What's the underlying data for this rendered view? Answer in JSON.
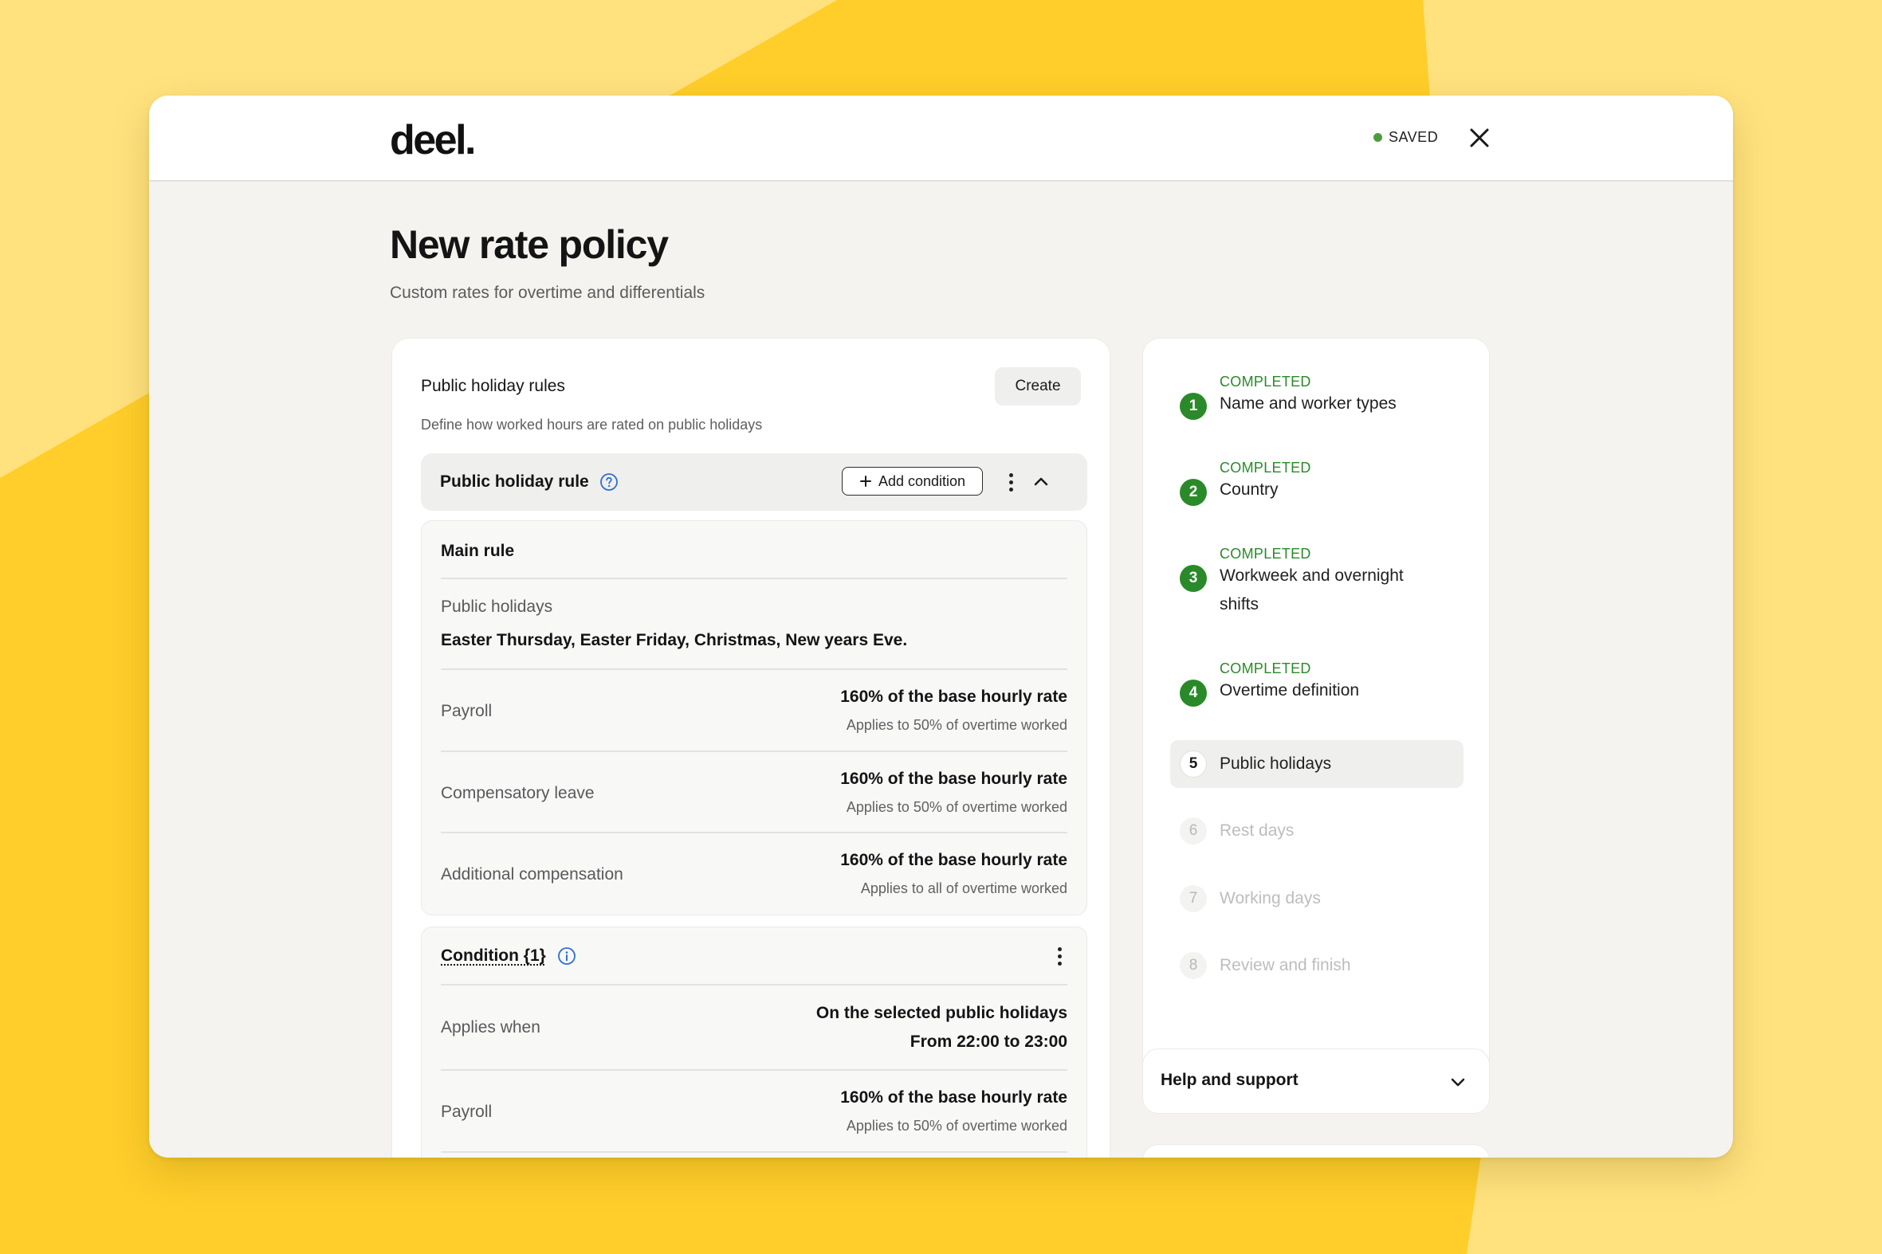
{
  "brand": {
    "logo_text": "deel.",
    "accent": "#ffce2a",
    "accent_light": "#ffe27e",
    "success": "#2a8a2a"
  },
  "header": {
    "saved_label": "SAVED",
    "close_icon": "close-icon"
  },
  "page": {
    "title": "New rate policy",
    "subtitle": "Custom rates for overtime and differentials"
  },
  "section": {
    "title": "Public holiday rules",
    "create_label": "Create",
    "description": "Define how worked hours are rated on public holidays"
  },
  "rule": {
    "title": "Public holiday rule",
    "add_condition_label": "Add condition",
    "main_rule": {
      "title": "Main rule",
      "holidays_label": "Public holidays",
      "holidays_value": "Easter Thursday, Easter Friday, Christmas, New years Eve.",
      "rows": [
        {
          "label": "Payroll",
          "value": "160% of the base hourly rate",
          "note": "Applies to 50% of overtime worked"
        },
        {
          "label": "Compensatory leave",
          "value": "160% of the base hourly rate",
          "note": "Applies to 50% of overtime worked"
        },
        {
          "label": "Additional compensation",
          "value": "160% of the base hourly rate",
          "note": "Applies to all of overtime worked"
        }
      ]
    },
    "condition": {
      "title": "Condition {1}",
      "applies_label": "Applies when",
      "applies_value_1": "On the selected public holidays",
      "applies_value_2": "From 22:00 to 23:00",
      "payroll": {
        "label": "Payroll",
        "value": "160% of the base hourly rate",
        "note": "Applies to 50% of overtime worked"
      }
    }
  },
  "steps": [
    {
      "num": "1",
      "status": "COMPLETED",
      "label": "Name and worker types"
    },
    {
      "num": "2",
      "status": "COMPLETED",
      "label": "Country"
    },
    {
      "num": "3",
      "status": "COMPLETED",
      "label": "Workweek and overnight",
      "label_2": "shifts"
    },
    {
      "num": "4",
      "status": "COMPLETED",
      "label": "Overtime definition"
    },
    {
      "num": "5",
      "label": "Public holidays"
    },
    {
      "num": "6",
      "label": "Rest days"
    },
    {
      "num": "7",
      "label": "Working days"
    },
    {
      "num": "8",
      "label": "Review and finish"
    }
  ],
  "help": {
    "label": "Help and support"
  }
}
